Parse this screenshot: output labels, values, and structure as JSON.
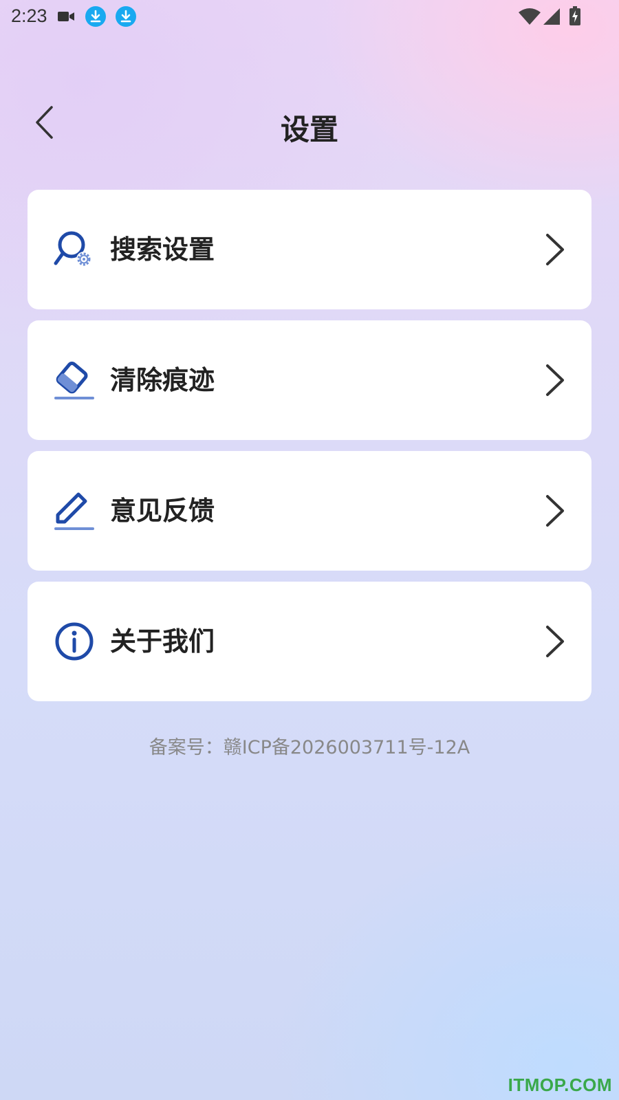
{
  "status_bar": {
    "time": "2:23",
    "icons": [
      "video-camera-icon",
      "download-icon",
      "download-icon",
      "wifi-icon",
      "signal-icon",
      "battery-charging-icon"
    ],
    "download_icon_color": "#19a9f0"
  },
  "header": {
    "title": "设置",
    "back_icon": "chevron-left-icon"
  },
  "menu": {
    "items": [
      {
        "label": "搜索设置",
        "icon": "search-settings-icon"
      },
      {
        "label": "清除痕迹",
        "icon": "eraser-icon"
      },
      {
        "label": "意见反馈",
        "icon": "edit-pen-icon"
      },
      {
        "label": "关于我们",
        "icon": "info-icon"
      }
    ],
    "icon_color": "#1f4aa8",
    "icon_accent": "#6f8fd6"
  },
  "footer": {
    "icp": "备案号：赣ICP备2026003711号-12A"
  },
  "watermark": "ITMOP.COM"
}
